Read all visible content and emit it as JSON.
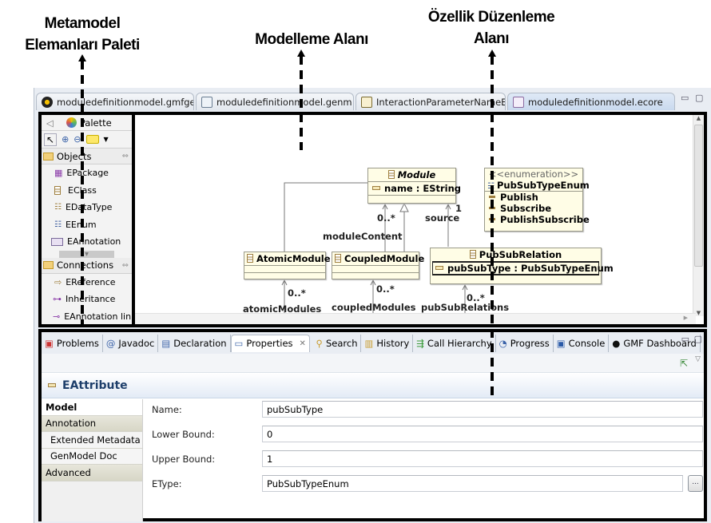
{
  "annotations": {
    "palette_label": [
      "Metamodel",
      "Elemanları Paleti"
    ],
    "canvas_label": "Modelleme Alanı",
    "properties_label": [
      "Özellik Düzenleme",
      "Alanı"
    ]
  },
  "editor_tabs": [
    {
      "label": "moduledefinitionmodel.gmfge",
      "icon": "gmfgen-icon"
    },
    {
      "label": "moduledefinitionmodel.genm",
      "icon": "genmodel-icon"
    },
    {
      "label": "InteractionParameterNameE",
      "icon": "java-file-icon"
    },
    {
      "label": "moduledefinitionmodel.ecore",
      "icon": "ecore-icon",
      "active": true,
      "close": "✕"
    }
  ],
  "palette": {
    "title": "Palette",
    "tools": [
      "select-tool",
      "zoom-in-tool",
      "zoom-out-tool",
      "note-tool"
    ],
    "objects_header": "Objects",
    "objects": [
      "EPackage",
      "EClass",
      "EDataType",
      "EEnum",
      "EAnnotation"
    ],
    "connections_header": "Connections",
    "connections": [
      "EReference",
      "Inheritance",
      "EAnnotation link"
    ]
  },
  "diagram": {
    "classes": {
      "module": {
        "name": "Module",
        "attribute": "name : EString"
      },
      "atomic": {
        "name": "AtomicModule"
      },
      "coupled": {
        "name": "CoupledModule"
      },
      "pubsub": {
        "name": "PubSubRelation",
        "attribute": "pubSubType : PubSubTypeEnum"
      },
      "enum": {
        "stereotype": "<<enumeration>>",
        "name": "PubSubTypeEnum",
        "literals": [
          "Publish",
          "Subscribe",
          "PublishSubscribe"
        ]
      }
    },
    "labels": {
      "module_content_mult": "0..*",
      "module_content": "moduleContent",
      "source_mult": "1",
      "source": "source",
      "atomic_mult": "0..*",
      "atomic_modules": "atomicModules",
      "coupled_mult": "0..*",
      "coupled_modules": "coupledModules",
      "pubsub_mult": "0..*",
      "pubsub_relations": "pubSubRelations"
    }
  },
  "views": {
    "tabs": [
      {
        "label": "Problems",
        "icon": "problems-icon"
      },
      {
        "label": "Javadoc",
        "icon": "at-icon"
      },
      {
        "label": "Declaration",
        "icon": "declaration-icon"
      },
      {
        "label": "Properties",
        "icon": "properties-icon",
        "active": true,
        "close": "✕"
      },
      {
        "label": "Search",
        "icon": "search-icon"
      },
      {
        "label": "History",
        "icon": "history-icon"
      },
      {
        "label": "Call Hierarchy",
        "icon": "call-hierarchy-icon"
      },
      {
        "label": "Progress",
        "icon": "progress-icon"
      },
      {
        "label": "Console",
        "icon": "console-icon"
      },
      {
        "label": "GMF Dashboard",
        "icon": "gmf-dashboard-icon"
      }
    ]
  },
  "properties": {
    "title": "EAttribute",
    "side_tabs": [
      {
        "label": "Model",
        "kind": "sel"
      },
      {
        "label": "Annotation",
        "kind": "grp"
      },
      {
        "label": "Extended Metadata",
        "kind": "sub"
      },
      {
        "label": "GenModel Doc",
        "kind": "sub"
      },
      {
        "label": "Advanced",
        "kind": "grp"
      }
    ],
    "fields": [
      {
        "label": "Name:",
        "value": "pubSubType"
      },
      {
        "label": "Lower Bound:",
        "value": "0"
      },
      {
        "label": "Upper Bound:",
        "value": "1"
      },
      {
        "label": "EType:",
        "value": "PubSubTypeEnum"
      }
    ],
    "browse_button": "..."
  }
}
